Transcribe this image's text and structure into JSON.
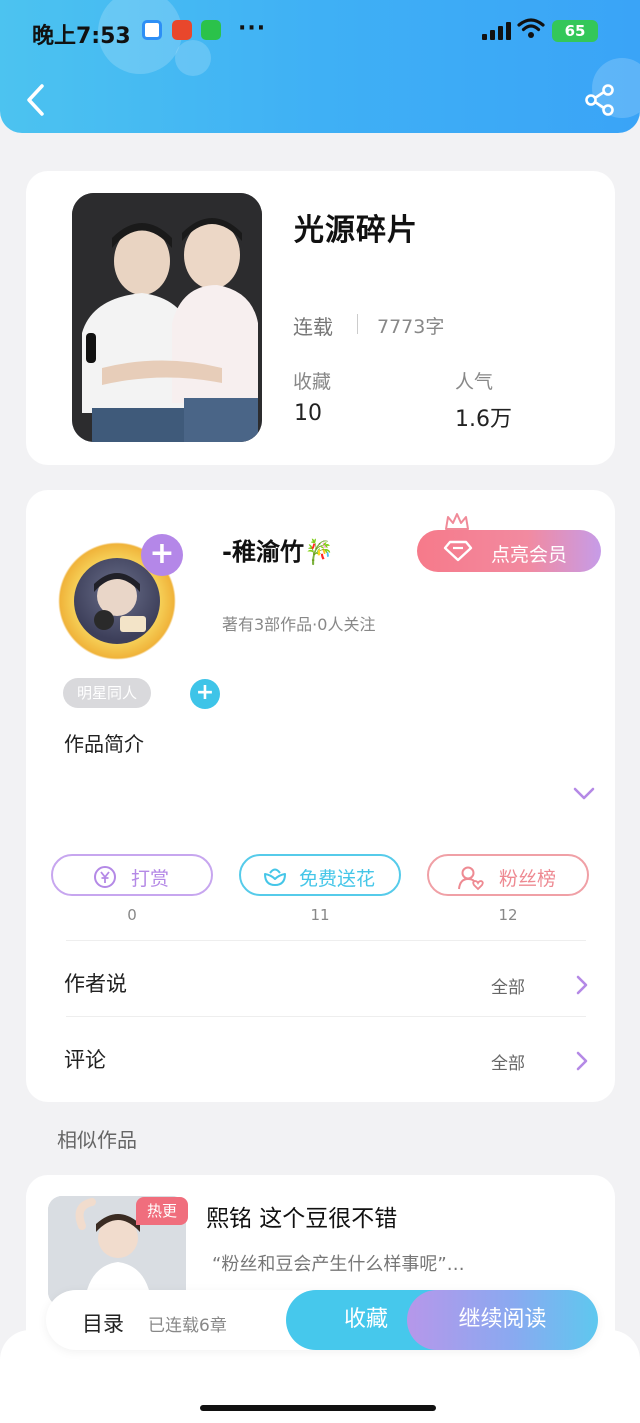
{
  "status_bar": {
    "time": "晚上7:53",
    "more": "···",
    "battery": "65"
  },
  "book": {
    "title": "光源碎片",
    "status": "连载",
    "words": "7773字",
    "collect_label": "收藏",
    "collect_value": "10",
    "popularity_label": "人气",
    "popularity_value": "1.6万"
  },
  "author": {
    "name": "-稚渝竹🎋",
    "meta": "著有3部作品·0人关注",
    "vip_label": "点亮会员",
    "tag": "明星同人",
    "intro_title": "作品简介"
  },
  "actions": [
    {
      "label": "打赏",
      "count": "0",
      "color": "#b489e6"
    },
    {
      "label": "免费送花",
      "count": "11",
      "color": "#45c6e8"
    },
    {
      "label": "粉丝榜",
      "count": "12",
      "color": "#ee8a92"
    }
  ],
  "rows": {
    "author_says": "作者说",
    "comments": "评论",
    "all_label": "全部"
  },
  "similar": {
    "section_title": "相似作品",
    "badge": "热更",
    "title": "熙铭 这个豆很不错",
    "desc": "“粉丝和豆会产生什么样事呢”…"
  },
  "bottom": {
    "toc": "目录",
    "chapters": "已连载6章",
    "collect": "收藏",
    "read": "继续阅读"
  }
}
